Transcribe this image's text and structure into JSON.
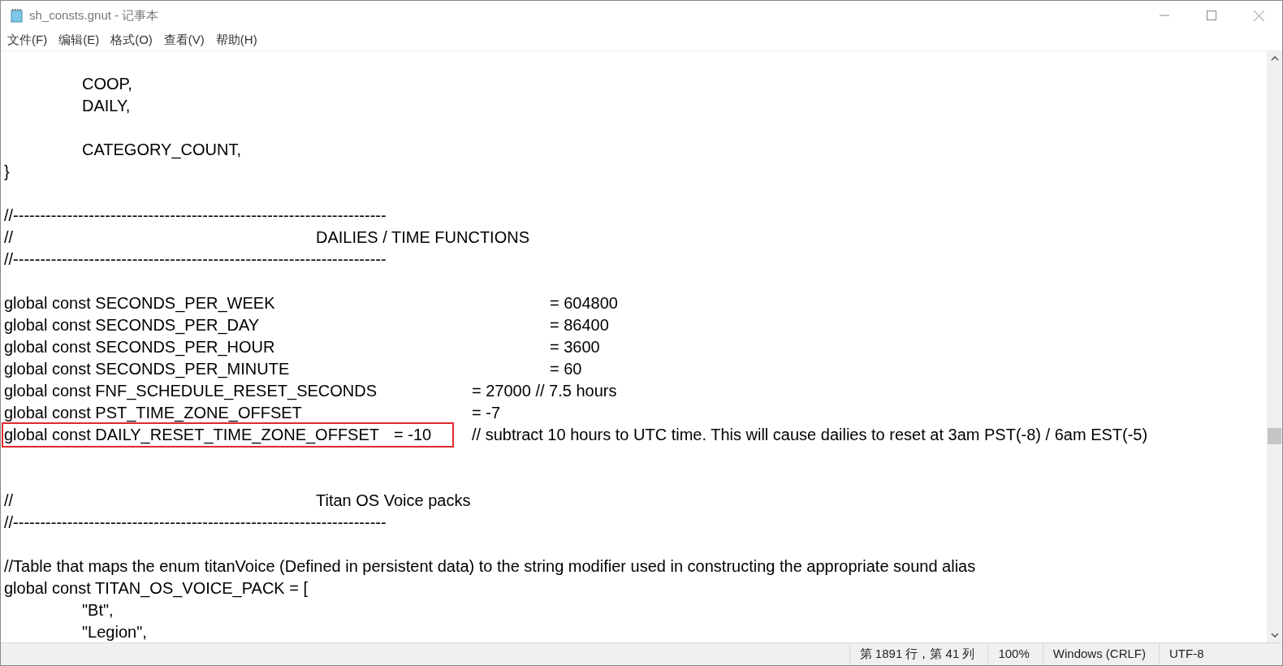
{
  "window": {
    "title": "sh_consts.gnut - 记事本"
  },
  "menu": [
    "文件(F)",
    "编辑(E)",
    "格式(O)",
    "查看(V)",
    "帮助(H)"
  ],
  "lines": [
    {
      "kind": "blank"
    },
    {
      "kind": "code",
      "segments": [
        {
          "text": "\tCOOP,",
          "boxed": false
        }
      ]
    },
    {
      "kind": "code",
      "segments": [
        {
          "text": "\tDAILY,",
          "boxed": false
        }
      ]
    },
    {
      "kind": "blank"
    },
    {
      "kind": "code",
      "segments": [
        {
          "text": "\tCATEGORY_COUNT,",
          "boxed": false
        }
      ]
    },
    {
      "kind": "code",
      "segments": [
        {
          "text": "}",
          "boxed": false
        }
      ]
    },
    {
      "kind": "blank"
    },
    {
      "kind": "code",
      "segments": [
        {
          "text": "//---------------------------------------------------------------------",
          "boxed": false
        }
      ]
    },
    {
      "kind": "code",
      "segments": [
        {
          "text": "//\t\t\t\tDAILIES / TIME FUNCTIONS",
          "boxed": false
        }
      ]
    },
    {
      "kind": "code",
      "segments": [
        {
          "text": "//---------------------------------------------------------------------",
          "boxed": false
        }
      ]
    },
    {
      "kind": "blank"
    },
    {
      "kind": "code",
      "segments": [
        {
          "text": "global const SECONDS_PER_WEEK\t\t\t\t= 604800",
          "boxed": false
        }
      ]
    },
    {
      "kind": "code",
      "segments": [
        {
          "text": "global const SECONDS_PER_DAY\t\t\t\t= 86400",
          "boxed": false
        }
      ]
    },
    {
      "kind": "code",
      "segments": [
        {
          "text": "global const SECONDS_PER_HOUR\t\t\t\t= 3600",
          "boxed": false
        }
      ]
    },
    {
      "kind": "code",
      "segments": [
        {
          "text": "global const SECONDS_PER_MINUTE\t\t\t\t= 60",
          "boxed": false
        }
      ]
    },
    {
      "kind": "code",
      "segments": [
        {
          "text": "global const FNF_SCHEDULE_RESET_SECONDS\t\t= 27000 // 7.5 hours",
          "boxed": false
        }
      ]
    },
    {
      "kind": "code",
      "segments": [
        {
          "text": "global const PST_TIME_ZONE_OFFSET\t\t\t= -7",
          "boxed": false
        }
      ]
    },
    {
      "kind": "code",
      "segments": [
        {
          "text": "global const DAILY_RESET_TIME_ZONE_OFFSET\t= -10",
          "boxed": true
        },
        {
          "text": "\t// subtract 10 hours to UTC time. This will cause dailies to reset at 3am PST(-8) / 6am EST(-5)",
          "boxed": false
        }
      ]
    },
    {
      "kind": "blank"
    },
    {
      "kind": "blank"
    },
    {
      "kind": "code",
      "segments": [
        {
          "text": "//\t\t\t\tTitan OS Voice packs",
          "boxed": false
        }
      ]
    },
    {
      "kind": "code",
      "segments": [
        {
          "text": "//---------------------------------------------------------------------",
          "boxed": false
        }
      ]
    },
    {
      "kind": "blank"
    },
    {
      "kind": "code",
      "segments": [
        {
          "text": "//Table that maps the enum titanVoice (Defined in persistent data) to the string modifier used in constructing the appropriate sound alias",
          "boxed": false
        }
      ]
    },
    {
      "kind": "code",
      "segments": [
        {
          "text": "global const TITAN_OS_VOICE_PACK = [",
          "boxed": false
        }
      ]
    },
    {
      "kind": "code",
      "segments": [
        {
          "text": "\t\"Bt\",",
          "boxed": false
        }
      ]
    },
    {
      "kind": "code",
      "segments": [
        {
          "text": "\t\"Legion\",",
          "boxed": false
        }
      ]
    }
  ],
  "status_bar": [
    "第 1891 行，第 41 列",
    "100%",
    "Windows (CRLF)",
    "UTF-8"
  ]
}
